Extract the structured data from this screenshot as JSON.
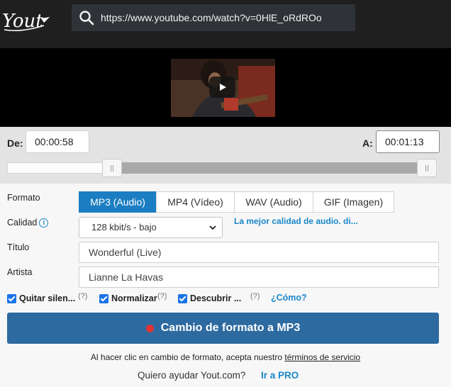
{
  "header": {
    "logo_text": "Yout",
    "url": "https://www.youtube.com/watch?v=0HlE_oRdROo"
  },
  "trim": {
    "from_label": "De:",
    "from_value": "00:00:58",
    "to_label": "A:",
    "to_value": "00:01:13"
  },
  "form": {
    "format_label": "Formato",
    "formats": [
      "MP3 (Audio)",
      "MP4 (Vídeo)",
      "WAV (Audio)",
      "GIF (Imagen)"
    ],
    "quality_label": "Calidad",
    "quality_value": "128 kbit/s - bajo",
    "quality_hint": "La mejor calidad de audio. di...",
    "title_label": "Título",
    "title_value": "Wonderful (Live)",
    "artist_label": "Artista",
    "artist_value": "Lianne La Havas"
  },
  "options": {
    "remove_silence": "Quitar silen...",
    "normalize": "Normalizar",
    "discover": "Descubrir ...",
    "help": "(?)",
    "how_link": "¿Cómo?"
  },
  "convert": {
    "button_label": "Cambio de formato a MP3",
    "terms_prefix": "Al hacer clic en cambio de formato, acepta nuestro",
    "terms_link": "términos de servicio",
    "promo_text": "Quiero ayudar Yout.com?",
    "pro_link": "Ir a PRO"
  },
  "colors": {
    "accent": "#1c7ec2",
    "convert": "#2d6aa0",
    "link": "#1a87c9"
  }
}
